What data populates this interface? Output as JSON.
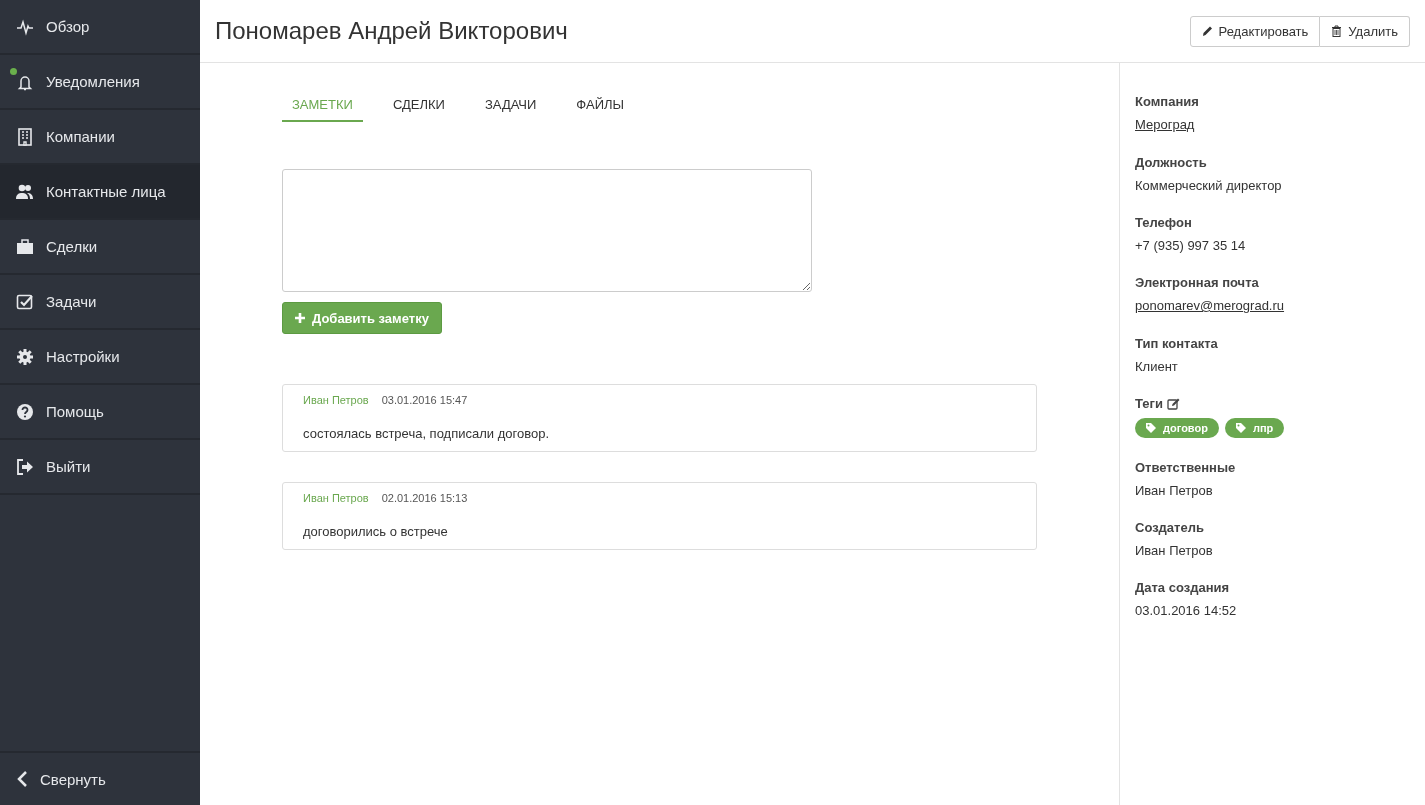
{
  "sidebar": {
    "items": [
      {
        "kind": "pulse",
        "label": "Обзор",
        "selected": false,
        "notification": false
      },
      {
        "kind": "bell",
        "label": "Уведомления",
        "selected": false,
        "notification": true
      },
      {
        "kind": "building",
        "label": "Компании",
        "selected": false,
        "notification": false
      },
      {
        "kind": "users",
        "label": "Контактные лица",
        "selected": true,
        "notification": false
      },
      {
        "kind": "briefcase",
        "label": "Сделки",
        "selected": false,
        "notification": false
      },
      {
        "kind": "checkbox",
        "label": "Задачи",
        "selected": false,
        "notification": false
      },
      {
        "kind": "gear",
        "label": "Настройки",
        "selected": false,
        "notification": false
      },
      {
        "kind": "help",
        "label": "Помощь",
        "selected": false,
        "notification": false
      },
      {
        "kind": "exit",
        "label": "Выйти",
        "selected": false,
        "notification": false
      }
    ],
    "collapse": "Свернуть"
  },
  "header": {
    "title": "Пономарев Андрей Викторович",
    "buttons": [
      {
        "kind": "edit",
        "label": "Редактировать"
      },
      {
        "kind": "delete",
        "label": "Удалить"
      }
    ]
  },
  "tabs": [
    {
      "label": "ЗАМЕТКИ",
      "selected": true
    },
    {
      "label": "СДЕЛКИ",
      "selected": false
    },
    {
      "label": "ЗАДАЧИ",
      "selected": false
    },
    {
      "label": "ФАЙЛЫ",
      "selected": false
    }
  ],
  "note_form": {
    "button": "Добавить заметку"
  },
  "notes": [
    {
      "author": "Иван Петров",
      "date": "03.01.2016 15:47",
      "text": "состоялась встреча, подписали договор."
    },
    {
      "author": "Иван Петров",
      "date": "02.01.2016 15:13",
      "text": "договорились о встрече"
    }
  ],
  "details": [
    {
      "kind": "link",
      "label": "Компания",
      "value": "Мероград"
    },
    {
      "kind": "text",
      "label": "Должность",
      "value": "Коммерческий директор"
    },
    {
      "kind": "text",
      "label": "Телефон",
      "value": "+7 (935) 997 35 14"
    },
    {
      "kind": "link",
      "label": "Электронная почта",
      "value": "ponomarev@merograd.ru"
    },
    {
      "kind": "text",
      "label": "Тип контакта",
      "value": "Клиент"
    },
    {
      "kind": "tags",
      "label": "Теги",
      "editable": true,
      "tags": [
        "договор",
        "лпр"
      ]
    },
    {
      "kind": "text",
      "label": "Ответственные",
      "value": "Иван Петров"
    },
    {
      "kind": "text",
      "label": "Создатель",
      "value": "Иван Петров"
    },
    {
      "kind": "text",
      "label": "Дата создания",
      "value": "03.01.2016 14:52"
    }
  ]
}
